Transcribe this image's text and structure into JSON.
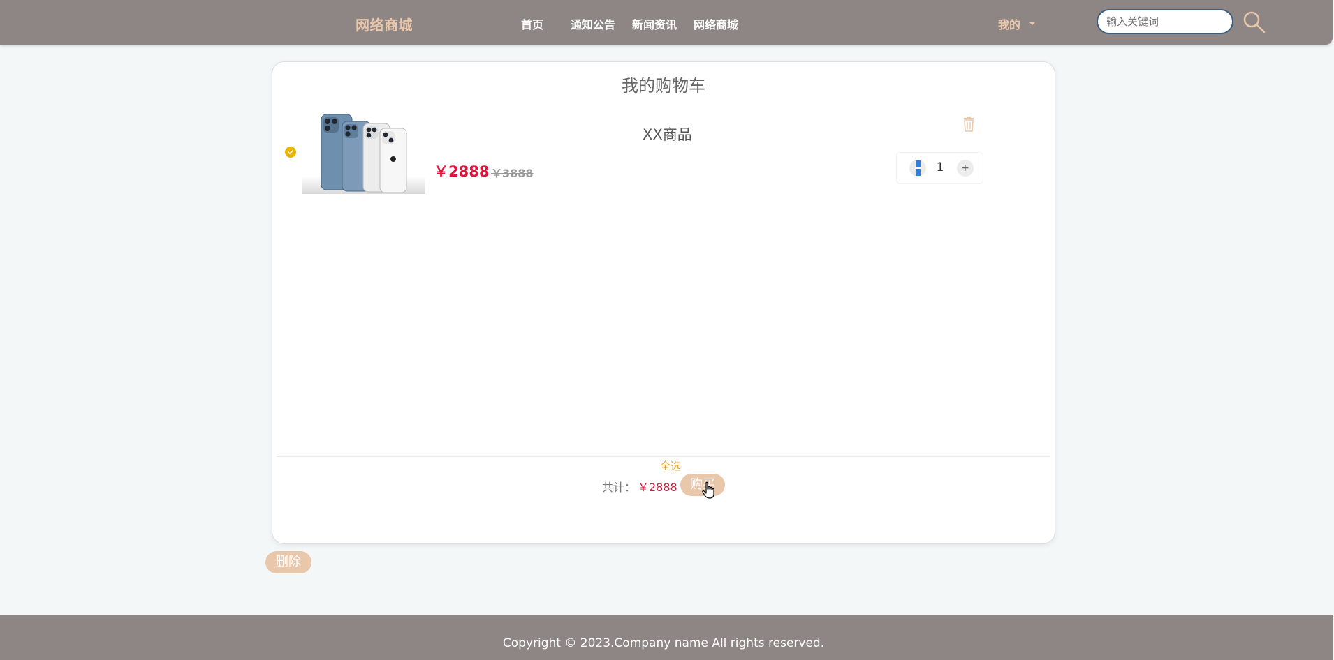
{
  "header": {
    "brand": "网络商城",
    "nav": [
      "首页",
      "通知公告",
      "新闻资讯",
      "网络商城"
    ],
    "user_menu": "我的",
    "search_placeholder": "输入关键词"
  },
  "cart": {
    "title": "我的购物车",
    "item": {
      "name": "XX商品",
      "price": "￥2888",
      "old_price": "￥3888",
      "quantity": "1",
      "checked": true
    },
    "select_all": "全选",
    "total_label": "共计：",
    "total_value": "￥2888",
    "buy_label": "购买",
    "delete_label": "删除"
  },
  "footer": {
    "copyright": "Copyright © 2023.Company name All rights reserved."
  },
  "colors": {
    "nav_bg": "#8e8585",
    "accent": "#e8c7ab",
    "price_red": "#e3143c",
    "check_yellow": "#e6b300"
  }
}
